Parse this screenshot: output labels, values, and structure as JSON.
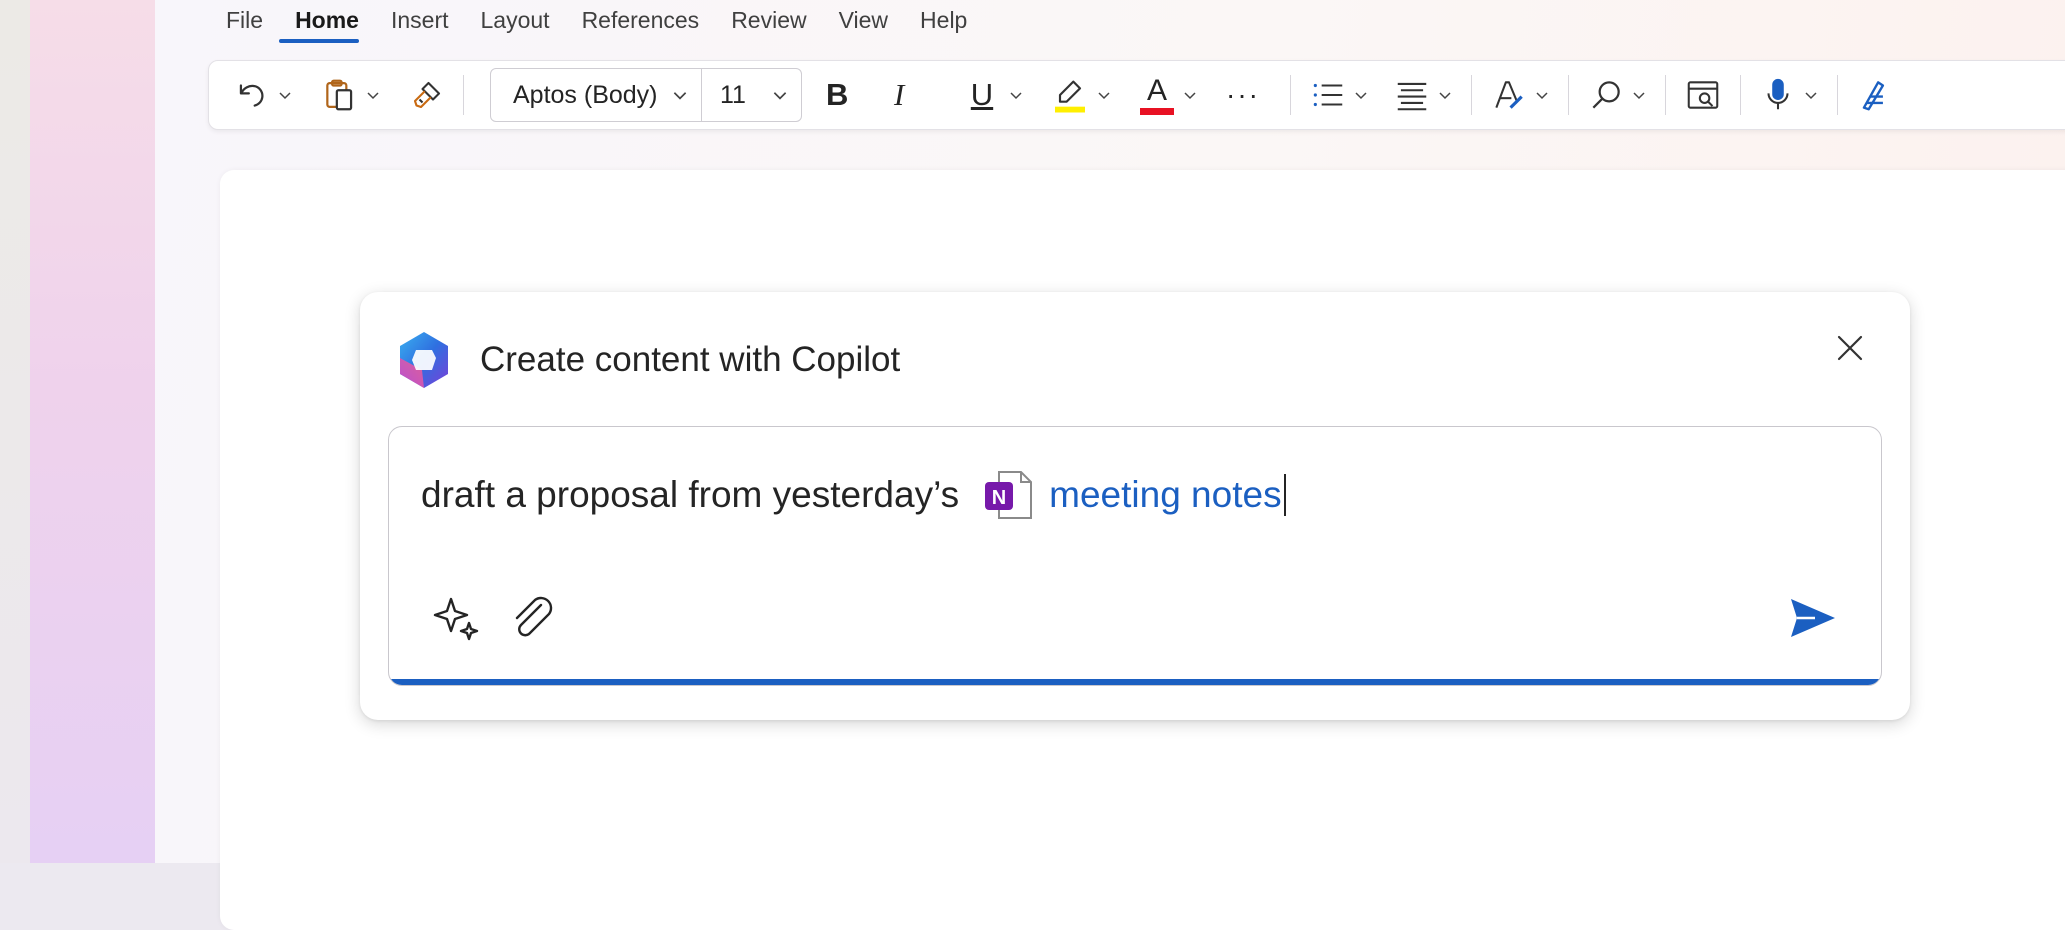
{
  "menu": {
    "items": [
      {
        "label": "File",
        "active": false
      },
      {
        "label": "Home",
        "active": true
      },
      {
        "label": "Insert",
        "active": false
      },
      {
        "label": "Layout",
        "active": false
      },
      {
        "label": "References",
        "active": false
      },
      {
        "label": "Review",
        "active": false
      },
      {
        "label": "View",
        "active": false
      },
      {
        "label": "Help",
        "active": false
      }
    ]
  },
  "toolbar": {
    "font_name": "Aptos (Body)",
    "font_size": "11",
    "bold_label": "B",
    "italic_label": "I",
    "underline_label": "U",
    "font_color_label": "A",
    "more_label": "···",
    "icons": [
      "undo-icon",
      "paste-icon",
      "format-painter-icon",
      "highlight-icon",
      "font-color-icon",
      "bullets-icon",
      "align-icon",
      "styles-icon",
      "find-icon",
      "reading-view-icon",
      "dictate-icon",
      "editor-icon"
    ]
  },
  "colors": {
    "accent": "#1b5fc1",
    "highlight": "#ffff00",
    "font_color": "#e81123",
    "onenote": "#7719aa"
  },
  "copilot": {
    "title": "Create content with Copilot",
    "prompt_text": "draft a proposal from yesterday’s",
    "reference_badge": "N",
    "reference_label": "meeting notes",
    "icons": [
      "copilot-logo-icon",
      "close-icon",
      "sparkle-icon",
      "attach-icon",
      "send-icon"
    ]
  }
}
